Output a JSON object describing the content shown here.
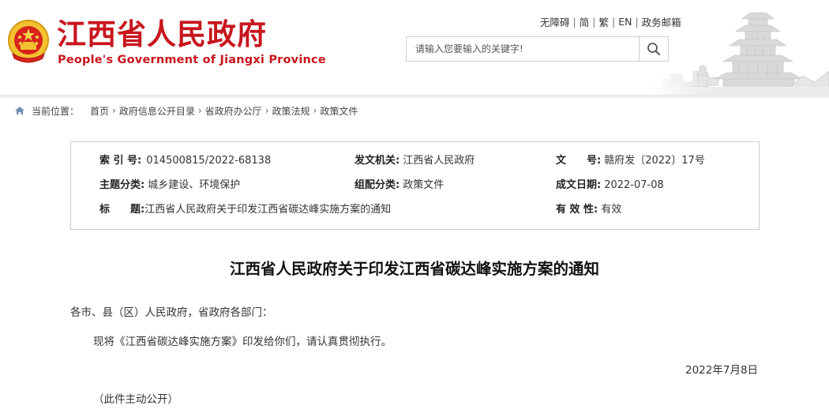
{
  "site": {
    "title": "江西省人民政府",
    "subtitle": "People's Government of Jiangxi Province"
  },
  "top_links": [
    "无障碍",
    "简",
    "繁",
    "EN",
    "政务邮箱"
  ],
  "search": {
    "placeholder": "请输入您要输入的关键字!"
  },
  "breadcrumb": {
    "label": "当前位置：",
    "items": [
      "首页",
      "政府信息公开目录",
      "省政府办公厅",
      "政策法规",
      "政策文件"
    ]
  },
  "info": {
    "index_no": {
      "label": "索 引 号:",
      "value": "014500815/2022-68138"
    },
    "issuer": {
      "label": "发文机关:",
      "value": "江西省人民政府"
    },
    "doc_no": {
      "label": "文　　号:",
      "value": "赣府发〔2022〕17号"
    },
    "topic": {
      "label": "主题分类:",
      "value": "城乡建设、环境保护"
    },
    "category": {
      "label": "组配分类:",
      "value": "政策文件"
    },
    "date": {
      "label": "成文日期:",
      "value": "2022-07-08"
    },
    "title": {
      "label": "标　　题:",
      "value": "江西省人民政府关于印发江西省碳达峰实施方案的通知"
    },
    "validity": {
      "label": "有 效 性:",
      "value": "有效"
    }
  },
  "article": {
    "title": "江西省人民政府关于印发江西省碳达峰实施方案的通知",
    "salutation": "各市、县（区）人民政府，省政府各部门：",
    "body": "现将《江西省碳达峰实施方案》印发给你们，请认真贯彻执行。",
    "date": "2022年7月8日",
    "note": "（此件主动公开）"
  },
  "colors": {
    "brand_red": "#c8161d",
    "emblem_gold": "#f2c230",
    "border_gray": "#cdcdcd"
  },
  "icons": [
    "national-emblem-icon",
    "search-icon",
    "home-icon",
    "tower-landscape-art"
  ]
}
